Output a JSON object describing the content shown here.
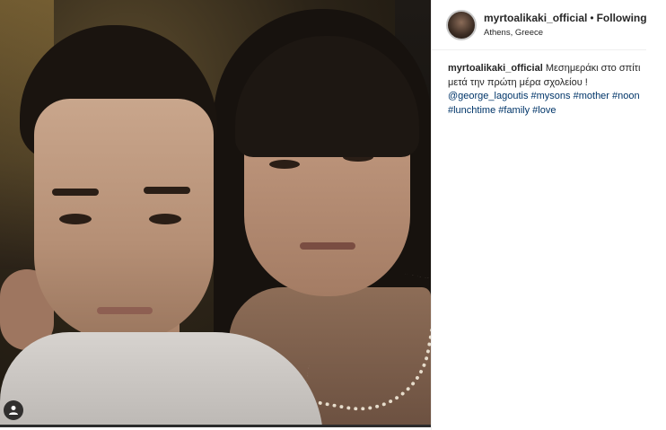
{
  "header": {
    "username": "myrtoalikaki_official",
    "separator": "•",
    "follow_status": "Following",
    "location": "Athens, Greece"
  },
  "caption": {
    "username": "myrtoalikaki_official",
    "text": "Μεσημεράκι στο σπίτι μετά την πρώτη μέρα σχολείου !",
    "mention": "@george_lagoutis",
    "hashtags": [
      "#mysons",
      "#mother",
      "#noon",
      "#lunchtime",
      "#family",
      "#love"
    ]
  },
  "photo": {
    "tag_icon": "person-tag-icon"
  },
  "colors": {
    "link": "#003569",
    "text": "#262626",
    "border": "#efefef"
  }
}
